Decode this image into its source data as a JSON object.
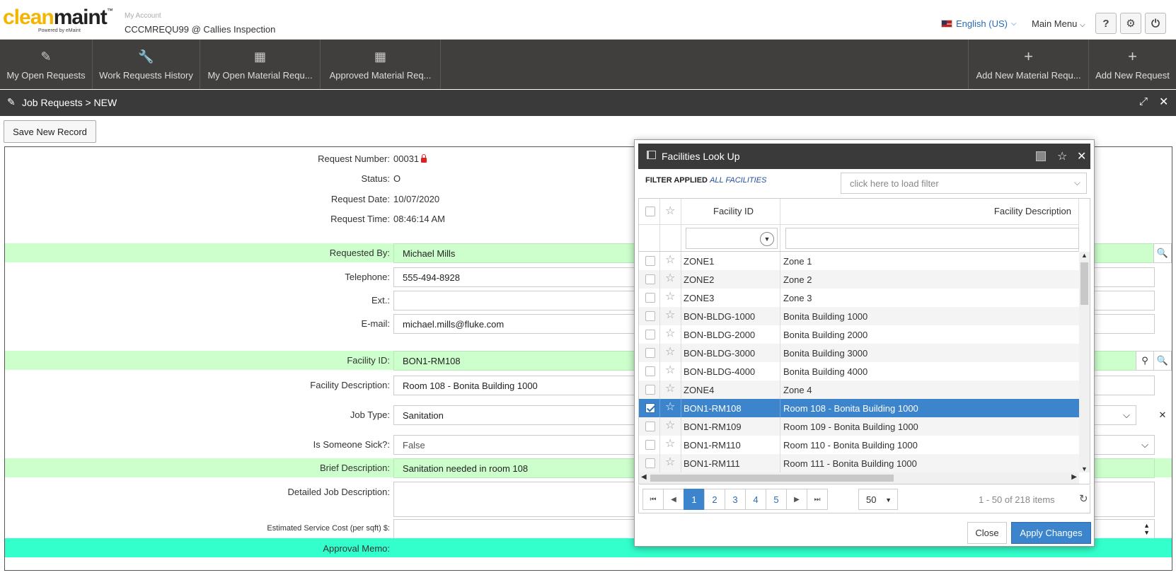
{
  "header": {
    "logo_main": "clean",
    "logo_accent": "maint",
    "logo_tm": "™",
    "logo_powered": "Powered by eMaint",
    "account_label": "My Account",
    "account_name": "CCCMREQU99 @ Callies Inspection",
    "language": "English (US)",
    "main_menu": "Main Menu",
    "help_icon": "question-icon",
    "settings_icon": "gear-icon",
    "power_icon": "power-icon"
  },
  "nav": {
    "items": [
      {
        "label": "My Open Requests",
        "icon": "pencil-icon"
      },
      {
        "label": "Work Requests History",
        "icon": "wrench-icon"
      },
      {
        "label": "My Open Material Requ...",
        "icon": "grid-icon"
      },
      {
        "label": "Approved Material Req...",
        "icon": "grid-icon"
      }
    ],
    "right_items": [
      {
        "label": "Add New Material Requ...",
        "icon": "plus-icon"
      },
      {
        "label": "Add New Request",
        "icon": "plus-icon"
      }
    ]
  },
  "breadcrumb": "Job Requests > NEW",
  "save_button": "Save New Record",
  "form": {
    "request_number_label": "Request Number:",
    "request_number": "00031",
    "status_label": "Status:",
    "status": "O",
    "request_date_label": "Request Date:",
    "request_date": "10/07/2020",
    "request_time_label": "Request Time:",
    "request_time": "08:46:14 AM",
    "requested_by_label": "Requested By:",
    "requested_by": "Michael Mills",
    "telephone_label": "Telephone:",
    "telephone": "555-494-8928",
    "ext_label": "Ext.:",
    "ext": "",
    "email_label": "E-mail:",
    "email": "michael.mills@fluke.com",
    "facility_id_label": "Facility ID:",
    "facility_id": "BON1-RM108",
    "facility_desc_label": "Facility Description:",
    "facility_desc": "Room 108 - Bonita Building 1000",
    "job_type_label": "Job Type:",
    "job_type": "Sanitation",
    "sick_label": "Is Someone Sick?:",
    "sick": "False",
    "brief_label": "Brief Description:",
    "brief": "Sanitation needed in room 108",
    "detailed_label": "Detailed Job Description:",
    "detailed": "",
    "cost_label": "Estimated Service Cost (per sqft) $:",
    "cost": "",
    "approval_label": "Approval Memo:"
  },
  "modal": {
    "title": "Facilities Look Up",
    "filter_label": "FILTER APPLIED",
    "filter_value": "ALL FACILITIES",
    "filter_placeholder": "click here to load filter",
    "col_facility_id": "Facility ID",
    "col_facility_desc": "Facility Description",
    "rows": [
      {
        "id": "ZONE1",
        "desc": "Zone 1",
        "checked": false
      },
      {
        "id": "ZONE2",
        "desc": "Zone 2",
        "checked": false
      },
      {
        "id": "ZONE3",
        "desc": "Zone 3",
        "checked": false
      },
      {
        "id": "BON-BLDG-1000",
        "desc": "Bonita Building 1000",
        "checked": false
      },
      {
        "id": "BON-BLDG-2000",
        "desc": "Bonita Building 2000",
        "checked": false
      },
      {
        "id": "BON-BLDG-3000",
        "desc": "Bonita Building 3000",
        "checked": false
      },
      {
        "id": "BON-BLDG-4000",
        "desc": "Bonita Building 4000",
        "checked": false
      },
      {
        "id": "ZONE4",
        "desc": "Zone 4",
        "checked": false
      },
      {
        "id": "BON1-RM108",
        "desc": "Room 108 - Bonita Building 1000",
        "checked": true
      },
      {
        "id": "BON1-RM109",
        "desc": "Room 109 - Bonita Building 1000",
        "checked": false
      },
      {
        "id": "BON1-RM110",
        "desc": "Room 110 - Bonita Building 1000",
        "checked": false
      },
      {
        "id": "BON1-RM111",
        "desc": "Room 111 - Bonita Building 1000",
        "checked": false
      }
    ],
    "pages": [
      "1",
      "2",
      "3",
      "4",
      "5"
    ],
    "active_page": "1",
    "page_size": "50",
    "page_info": "1 - 50 of 218 items",
    "close_button": "Close",
    "apply_button": "Apply Changes"
  },
  "colors": {
    "nav_bg": "#403f3d",
    "required_green": "#ccffcc",
    "approval_teal": "#33ffcc",
    "selected_row": "#3c84cc"
  }
}
